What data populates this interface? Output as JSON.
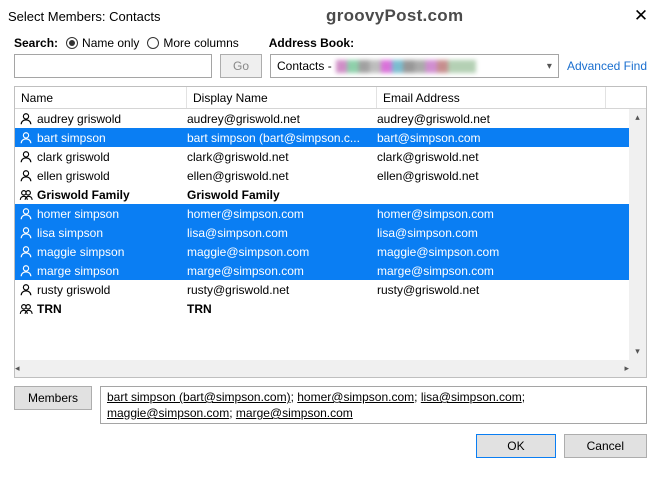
{
  "window": {
    "title": "Select Members: Contacts",
    "watermark": "groovyPost.com"
  },
  "search": {
    "label": "Search:",
    "opt1": "Name only",
    "opt2": "More columns",
    "go": "Go",
    "ab_label": "Address Book:",
    "combo_text": "Contacts -",
    "adv": "Advanced Find"
  },
  "columns": {
    "name": "Name",
    "display": "Display Name",
    "email": "Email Address"
  },
  "rows": [
    {
      "type": "person",
      "name": "audrey griswold",
      "display": "audrey@griswold.net",
      "email": "audrey@griswold.net",
      "selected": false
    },
    {
      "type": "person",
      "name": "bart simpson",
      "display": "bart simpson (bart@simpson.c...",
      "email": "bart@simpson.com",
      "selected": true
    },
    {
      "type": "person",
      "name": "clark griswold",
      "display": "clark@griswold.net",
      "email": "clark@griswold.net",
      "selected": false
    },
    {
      "type": "person",
      "name": "ellen griswold",
      "display": "ellen@griswold.net",
      "email": "ellen@griswold.net",
      "selected": false
    },
    {
      "type": "group",
      "name": "Griswold Family",
      "display": "Griswold Family",
      "email": "",
      "selected": false,
      "bold": true
    },
    {
      "type": "person",
      "name": "homer simpson",
      "display": "homer@simpson.com",
      "email": "homer@simpson.com",
      "selected": true
    },
    {
      "type": "person",
      "name": "lisa simpson",
      "display": "lisa@simpson.com",
      "email": "lisa@simpson.com",
      "selected": true
    },
    {
      "type": "person",
      "name": "maggie simpson",
      "display": "maggie@simpson.com",
      "email": "maggie@simpson.com",
      "selected": true
    },
    {
      "type": "person",
      "name": "marge simpson",
      "display": "marge@simpson.com",
      "email": "marge@simpson.com",
      "selected": true
    },
    {
      "type": "person",
      "name": "rusty griswold",
      "display": "rusty@griswold.net",
      "email": "rusty@griswold.net",
      "selected": false
    },
    {
      "type": "group",
      "name": "TRN",
      "display": "TRN",
      "email": "",
      "selected": false,
      "bold": true
    }
  ],
  "members": {
    "btn": "Members",
    "list": [
      "bart simpson (bart@simpson.com)",
      "homer@simpson.com",
      "lisa@simpson.com",
      "maggie@simpson.com",
      "marge@simpson.com"
    ]
  },
  "buttons": {
    "ok": "OK",
    "cancel": "Cancel"
  }
}
